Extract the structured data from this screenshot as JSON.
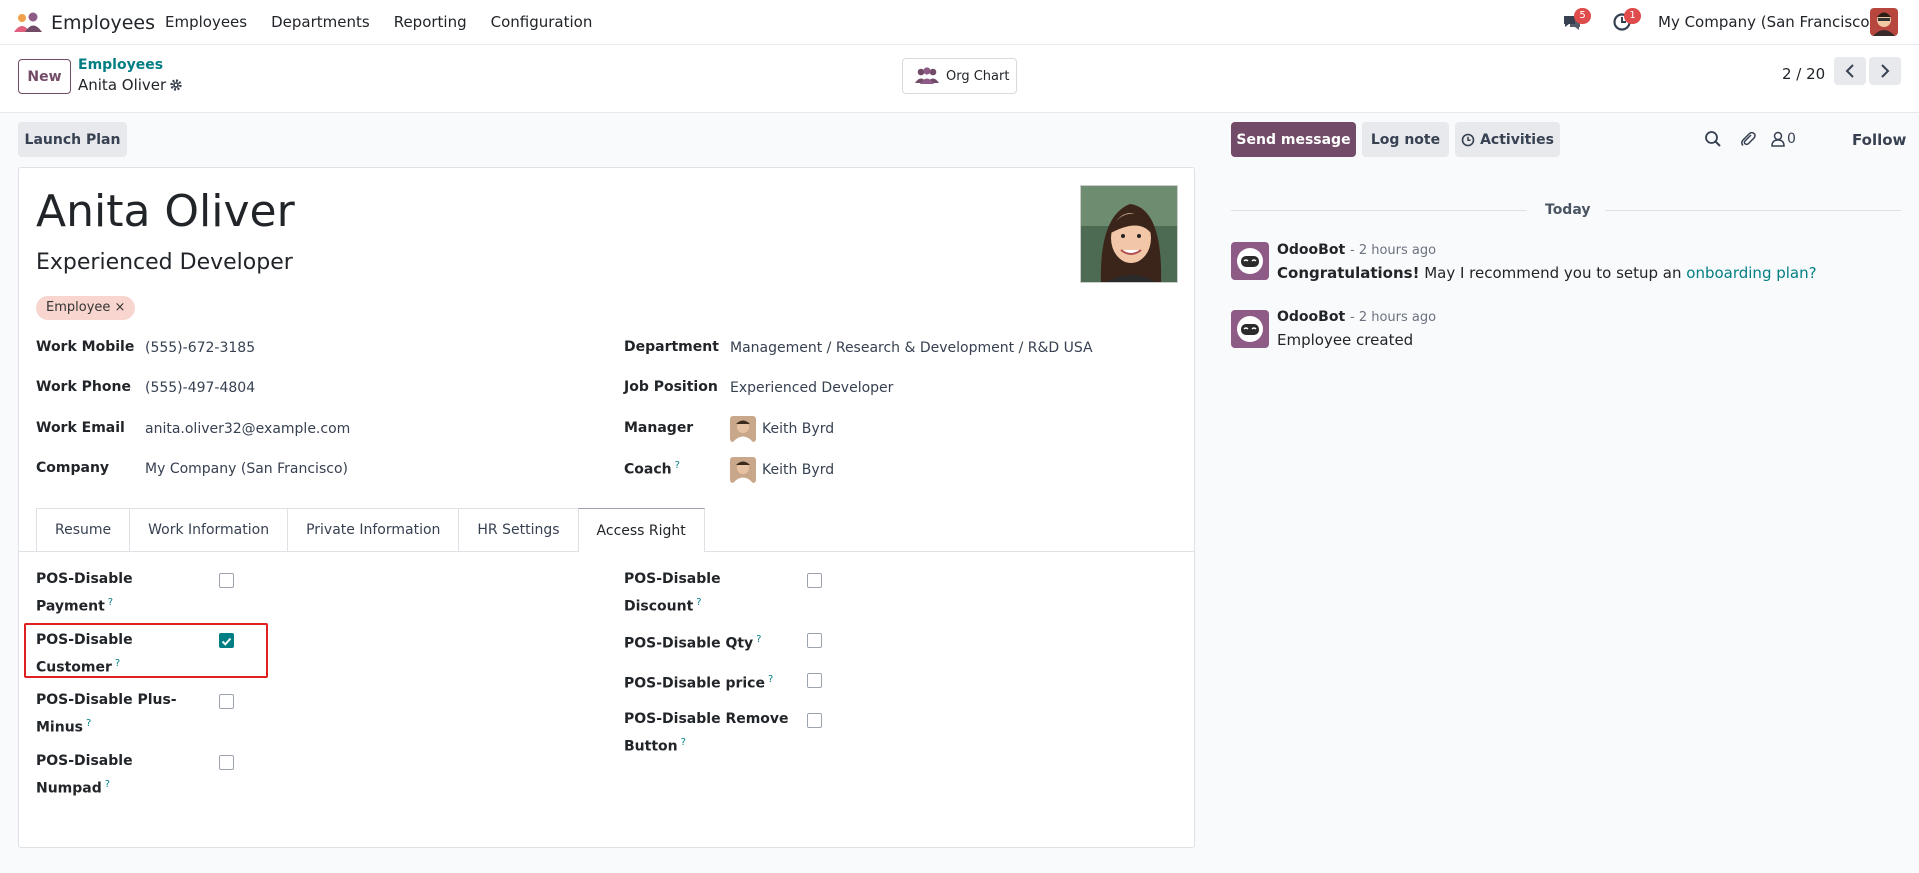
{
  "navbar": {
    "app_name": "Employees",
    "menu": [
      "Employees",
      "Departments",
      "Reporting",
      "Configuration"
    ],
    "messages_badge": "5",
    "activities_badge": "1",
    "company": "My Company (San Francisco)"
  },
  "control": {
    "new_label": "New",
    "breadcrumb_parent": "Employees",
    "breadcrumb_current": "Anita Oliver",
    "org_chart_label": "Org Chart",
    "pager": "2 / 20"
  },
  "form": {
    "launch_plan_label": "Launch Plan",
    "name": "Anita Oliver",
    "job_title": "Experienced Developer",
    "tag": "Employee",
    "fields_left": [
      {
        "label": "Work Mobile",
        "value": "(555)-672-3185"
      },
      {
        "label": "Work Phone",
        "value": "(555)-497-4804"
      },
      {
        "label": "Work Email",
        "value": "anita.oliver32@example.com"
      },
      {
        "label": "Company",
        "value": "My Company (San Francisco)"
      }
    ],
    "fields_right": [
      {
        "label": "Department",
        "value": "Management / Research & Development / R&D USA"
      },
      {
        "label": "Job Position",
        "value": "Experienced Developer"
      },
      {
        "label": "Manager",
        "value": "Keith Byrd"
      },
      {
        "label": "Coach",
        "value": "Keith Byrd"
      }
    ],
    "help_mark": "?",
    "tabs": [
      "Resume",
      "Work Information",
      "Private Information",
      "HR Settings",
      "Access Right"
    ],
    "active_tab": "Access Right",
    "access_left": [
      {
        "line1": "POS-Disable",
        "line2": "Payment",
        "checked": false
      },
      {
        "line1": "POS-Disable",
        "line2": "Customer",
        "checked": true
      },
      {
        "line1": "POS-Disable Plus-",
        "line2": "Minus",
        "checked": false
      },
      {
        "line1": "POS-Disable",
        "line2": "Numpad",
        "checked": false
      }
    ],
    "access_right": [
      {
        "line1": "POS-Disable",
        "line2": "Discount",
        "checked": false
      },
      {
        "line1": "POS-Disable Qty",
        "line2": "",
        "checked": false
      },
      {
        "line1": "POS-Disable price",
        "line2": "",
        "checked": false
      },
      {
        "line1": "POS-Disable Remove",
        "line2": "Button",
        "checked": false
      }
    ]
  },
  "chatter": {
    "send_message_label": "Send message",
    "log_note_label": "Log note",
    "activities_label": "Activities",
    "followers_count": "0",
    "follow_label": "Follow",
    "today_label": "Today",
    "messages": [
      {
        "author": "OdooBot",
        "date": "- 2 hours ago",
        "bold_prefix": "Congratulations!",
        "text": " May I recommend you to setup an ",
        "link": "onboarding plan?"
      },
      {
        "author": "OdooBot",
        "date": "- 2 hours ago",
        "bold_prefix": "",
        "text": "Employee created",
        "link": ""
      }
    ]
  },
  "colors": {
    "brand": "#714b67",
    "link": "#017e84",
    "tag_bg": "#f8d6cf",
    "highlight": "#e02020"
  }
}
